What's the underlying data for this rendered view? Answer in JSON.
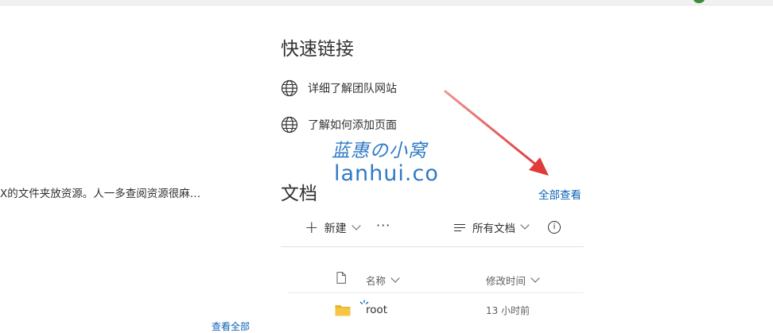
{
  "left": {
    "snippet": "X的文件夹放资源。人一多查阅资源很麻…",
    "bottom_link": "查看全部"
  },
  "quick_links": {
    "title": "快速链接",
    "items": [
      {
        "label": "详细了解团队网站",
        "icon": "globe-icon"
      },
      {
        "label": "了解如何添加页面",
        "icon": "globe-icon"
      }
    ]
  },
  "watermark": {
    "cn": "蓝惠の小窝",
    "en": "lanhui.co"
  },
  "documents": {
    "title": "文档",
    "see_all": "全部查看",
    "toolbar": {
      "new_label": "新建",
      "more_label": "···",
      "view_label": "所有文档",
      "info_label": "i"
    },
    "columns": {
      "name": "名称",
      "modified": "修改时间"
    },
    "rows": [
      {
        "name": "root",
        "modified": "13 小时前",
        "icon": "folder-icon"
      }
    ]
  },
  "colors": {
    "link": "#0b61b8",
    "arrow": "#e03a3a",
    "watermark": "#2e7ac4",
    "folder": "#f5c543"
  }
}
